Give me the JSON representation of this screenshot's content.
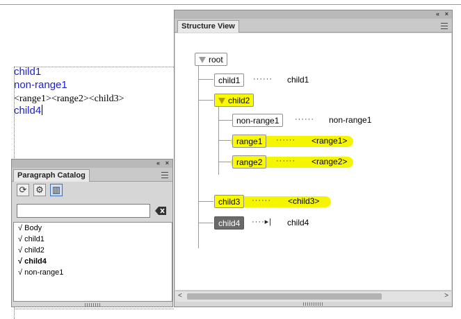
{
  "document": {
    "lines": [
      {
        "text": "child1"
      },
      {
        "text": "non-range1"
      },
      {
        "text": "<range1><range2><child3>"
      },
      {
        "text": "child4"
      }
    ]
  },
  "structure_view": {
    "tab_label": "Structure View",
    "collapse_glyph": "«",
    "close_glyph": "×",
    "nodes": {
      "root": "root",
      "child1": "child1",
      "child2": "child2",
      "non_range1": "non-range1",
      "range1": "range1",
      "range2": "range2",
      "child3": "child3",
      "child4": "child4"
    },
    "values": {
      "child1": "child1",
      "non_range1": "non-range1",
      "range1": "<range1>",
      "range2": "<range2>",
      "child3": "<child3>",
      "child4": "child4"
    },
    "highlight_color": "#fbfb00"
  },
  "paragraph_catalog": {
    "tab_label": "Paragraph Catalog",
    "search_value": "",
    "items": [
      {
        "check": "√",
        "label": "Body"
      },
      {
        "check": "√",
        "label": "child1"
      },
      {
        "check": "√",
        "label": "child2"
      },
      {
        "check": "√",
        "label": "child4"
      },
      {
        "check": "√",
        "label": "non-range1"
      }
    ]
  }
}
